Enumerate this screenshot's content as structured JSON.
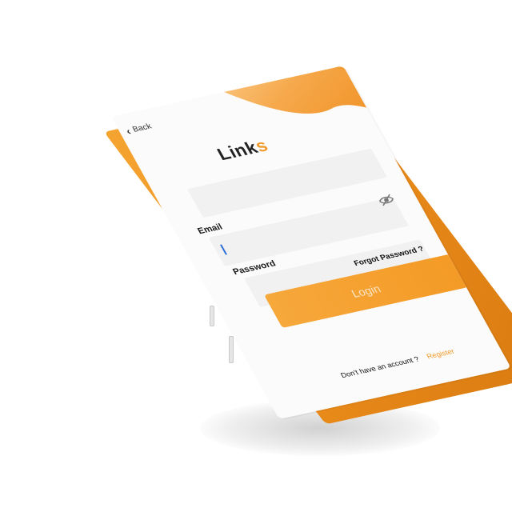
{
  "app": {
    "logo_part1": "Lin",
    "logo_part2": "k",
    "logo_part3": "s"
  },
  "header": {
    "back_label": "Back",
    "back_icon": "chevron-left-icon"
  },
  "form": {
    "email_label": "Email",
    "email_value": "",
    "password_label": "Password",
    "password_value": "",
    "password_toggle_icon": "eye-off-icon",
    "forgot_label": "Forgot Password ?",
    "login_label": "Login"
  },
  "footer": {
    "no_account_text": "Don't have an account ?",
    "register_label": "Register"
  },
  "colors": {
    "accent": "#f49a26",
    "case": "#e98b1a",
    "screen_bg": "#fbfbfb",
    "field_bg": "#f1f1f1"
  }
}
